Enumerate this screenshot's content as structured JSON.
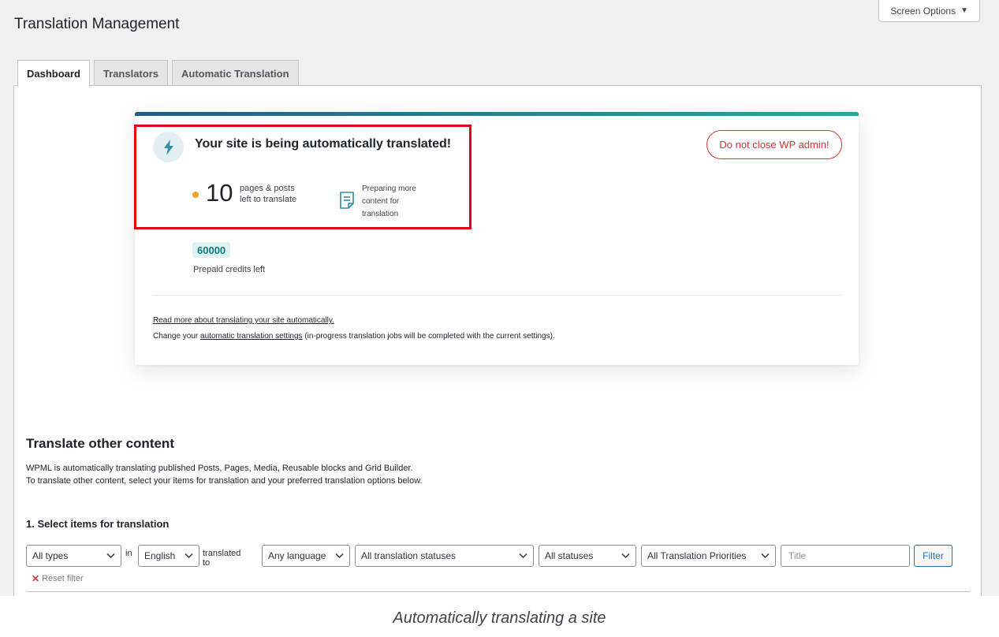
{
  "header": {
    "screen_options_label": "Screen Options",
    "page_title": "Translation Management"
  },
  "tabs": [
    {
      "label": "Dashboard",
      "active": true
    },
    {
      "label": "Translators",
      "active": false
    },
    {
      "label": "Automatic Translation",
      "active": false
    }
  ],
  "status_card": {
    "headline": "Your site is being automatically translated!",
    "warning_button": "Do not close WP admin!",
    "pending_count": "10",
    "pending_label_line1": "pages & posts",
    "pending_label_line2": "left to translate",
    "preparing_line1": "Preparing more",
    "preparing_line2": "content for",
    "preparing_line3": "translation",
    "credits_value": "60000",
    "credits_label": "Prepaid credits left",
    "read_more_link": "Read more about translating your site automatically.",
    "change_prefix": "Change your ",
    "change_link": "automatic translation settings",
    "change_suffix": " (in-progress translation jobs will be completed with the current settings).",
    "accent_color": "#1f8ea0",
    "warning_color": "#d63638"
  },
  "other_content": {
    "title": "Translate other content",
    "desc_line1": "WPML is automatically translating published Posts, Pages, Media, Reusable blocks and Grid Builder.",
    "desc_line2": "To translate other content, select your items for translation and your preferred translation options below."
  },
  "select_items": {
    "step_title": "1. Select items for translation",
    "type_select": "All types",
    "in_text": "in",
    "language_select": "English",
    "translated_to_text": "translated to",
    "target_select": "Any language",
    "translation_status_select": "All translation statuses",
    "status_select": "All statuses",
    "priority_select": "All Translation Priorities",
    "title_placeholder": "Title",
    "filter_button": "Filter",
    "reset_filter": "Reset filter"
  },
  "caption": "Automatically translating a site"
}
